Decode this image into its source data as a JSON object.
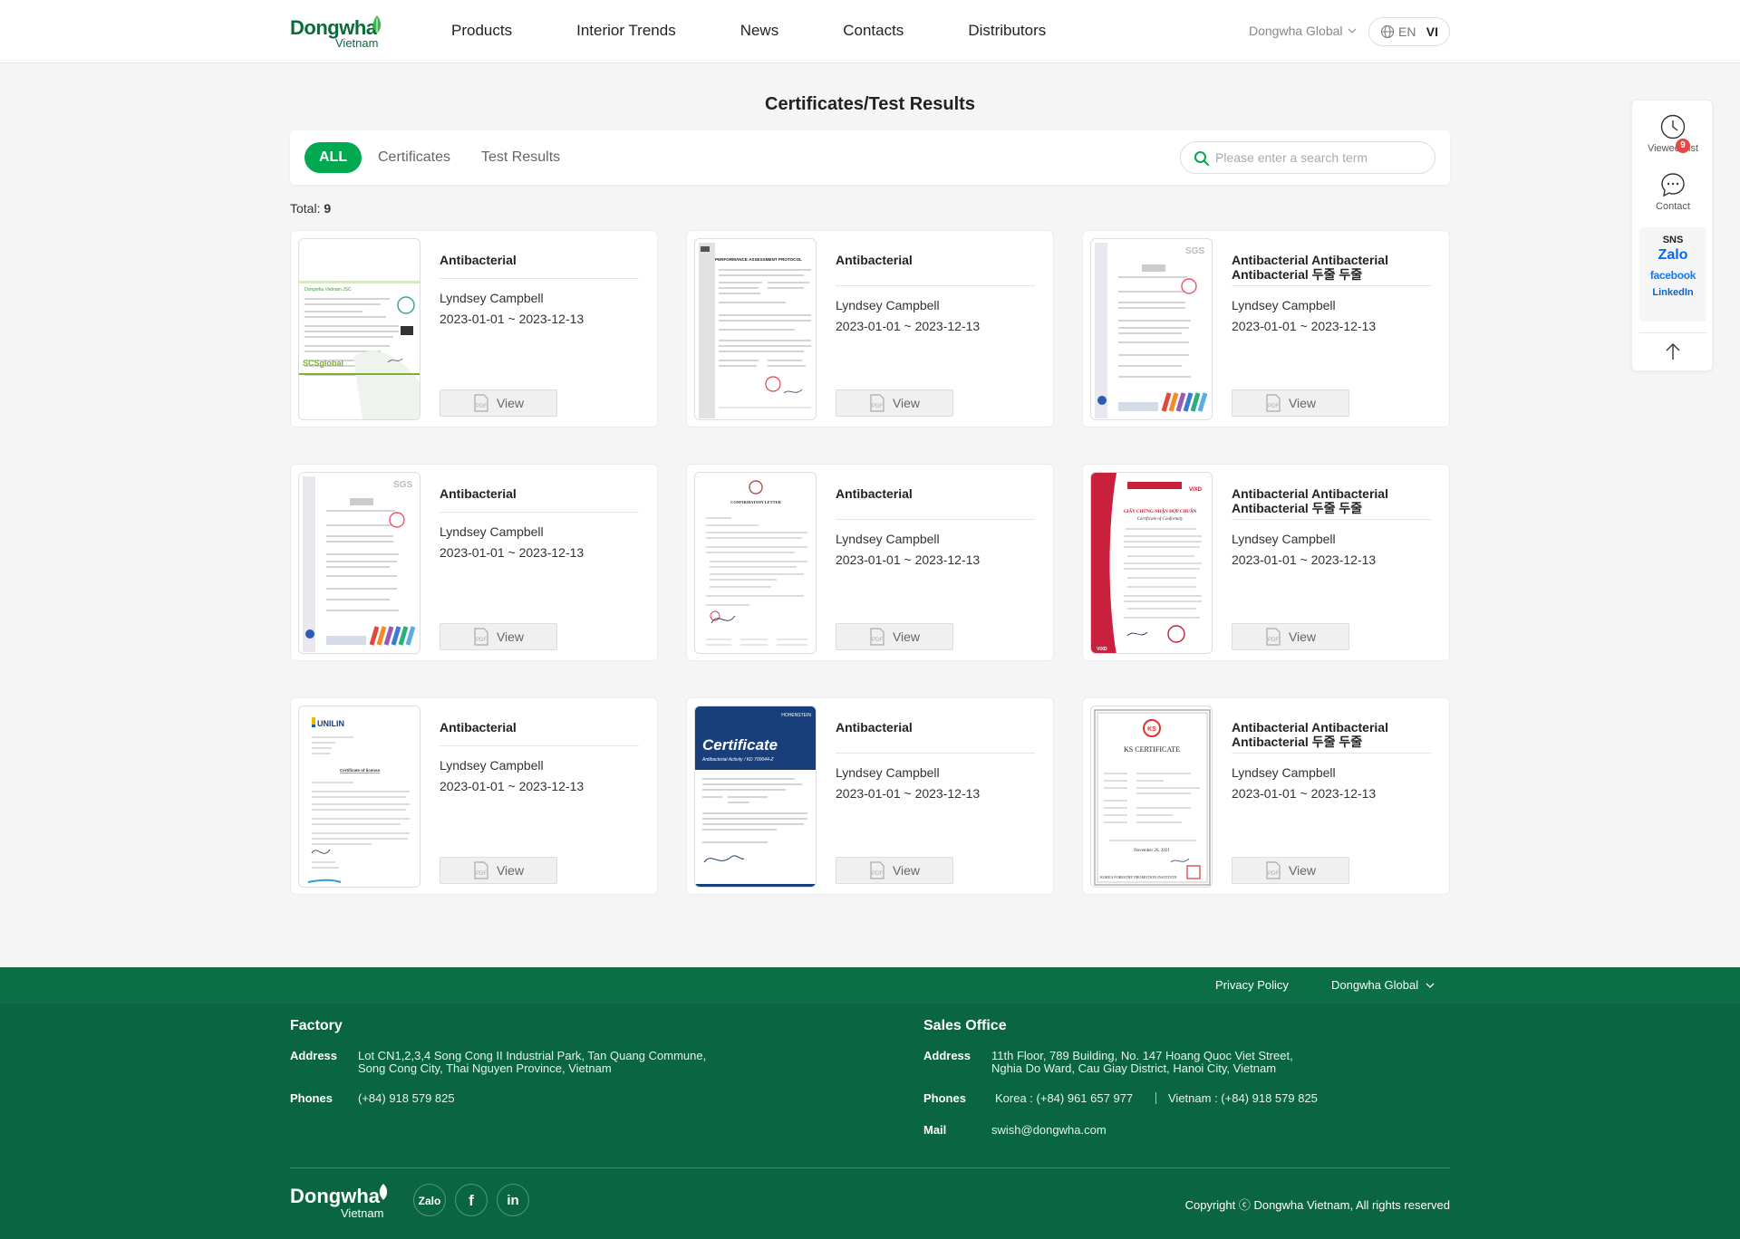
{
  "header": {
    "logo_text": "Dongwha",
    "logo_sub": "Vietnam",
    "nav": [
      "Products",
      "Interior Trends",
      "News",
      "Contacts",
      "Distributors"
    ],
    "region": "Dongwha Global",
    "lang_en": "EN",
    "lang_vi": "VI"
  },
  "page": {
    "title": "Certificates/Test Results",
    "tabs": [
      "ALL",
      "Certificates",
      "Test Results"
    ],
    "search_placeholder": "Please enter a search term",
    "total_label": "Total:",
    "total_value": "9"
  },
  "cards": [
    {
      "title": "Antibacterial",
      "name": "Lyndsey Campbell",
      "date": "2023-01-01 ~ 2023-12-13",
      "view": "View"
    },
    {
      "title": "Antibacterial",
      "name": "Lyndsey Campbell",
      "date": "2023-01-01 ~ 2023-12-13",
      "view": "View"
    },
    {
      "title": "Antibacterial Antibacterial Antibacterial 두줄 두줄",
      "name": "Lyndsey Campbell",
      "date": "2023-01-01 ~ 2023-12-13",
      "view": "View"
    },
    {
      "title": "Antibacterial",
      "name": "Lyndsey Campbell",
      "date": "2023-01-01 ~ 2023-12-13",
      "view": "View"
    },
    {
      "title": "Antibacterial",
      "name": "Lyndsey Campbell",
      "date": "2023-01-01 ~ 2023-12-13",
      "view": "View"
    },
    {
      "title": "Antibacterial Antibacterial Antibacterial 두줄 두줄",
      "name": "Lyndsey Campbell",
      "date": "2023-01-01 ~ 2023-12-13",
      "view": "View"
    },
    {
      "title": "Antibacterial",
      "name": "Lyndsey Campbell",
      "date": "2023-01-01 ~ 2023-12-13",
      "view": "View"
    },
    {
      "title": "Antibacterial",
      "name": "Lyndsey Campbell",
      "date": "2023-01-01 ~ 2023-12-13",
      "view": "View"
    },
    {
      "title": "Antibacterial Antibacterial Antibacterial 두줄 두줄",
      "name": "Lyndsey Campbell",
      "date": "2023-01-01 ~ 2023-12-13",
      "view": "View"
    }
  ],
  "thumbnails": {
    "t1_brand": "Dongwha Vietnam JSC",
    "t1_logo": "SCSglobal",
    "t2_head": "PERFORMANCE ASSESSMENT PROTOCOL",
    "t3_brand": "SGS",
    "t5_head": "CONFIRMATION LETTER",
    "t6_head": "GIẤY CHỨNG NHẬN HỢP CHUẨN",
    "t6_sub": "Certificate of Conformity",
    "t6_brand": "VIXD",
    "t7_brand": "UNILIN",
    "t7_head": "Certificate of license",
    "t8_head": "Certificate",
    "t8_sub": "Antibacterial Activity / KD 700044-Z",
    "t8_brand": "HOHENSTEIN",
    "t9_head": "KS CERTIFICATE",
    "t9_foot": "KOREA FORESTRY PROMOTION INSTITUTE",
    "t9_date": "November 26, 2021"
  },
  "side": {
    "viewed_label": "Viewed List",
    "viewed_count": "9",
    "contact_label": "Contact",
    "sns_label": "SNS",
    "zalo": "Zalo",
    "facebook": "facebook",
    "linkedin": "LinkedIn"
  },
  "footer": {
    "privacy": "Privacy Policy",
    "region": "Dongwha Global",
    "factory": {
      "heading": "Factory",
      "address_label": "Address",
      "address_1": "Lot CN1,2,3,4 Song Cong II Industrial Park, Tan Quang Commune,",
      "address_2": "Song Cong City, Thai Nguyen Province, Vietnam",
      "phones_label": "Phones",
      "phones": "(+84) 918 579 825"
    },
    "sales": {
      "heading": "Sales Office",
      "address_label": "Address",
      "address_1": "11th Floor, 789 Building, No. 147 Hoang Quoc Viet Street,",
      "address_2": "Nghia Do Ward, Cau Giay District, Hanoi City, Vietnam",
      "phones_label": "Phones",
      "phones_korea": "Korea : (+84) 961 657 977",
      "phones_vietnam": "Vietnam : (+84) 918 579 825",
      "mail_label": "Mail",
      "mail": "swish@dongwha.com"
    },
    "logo_text": "Dongwha",
    "logo_sub": "Vietnam",
    "social": [
      "Zalo",
      "f",
      "in"
    ],
    "copyright": "Copyright ⓒ Dongwha Vietnam, All rights reserved"
  }
}
